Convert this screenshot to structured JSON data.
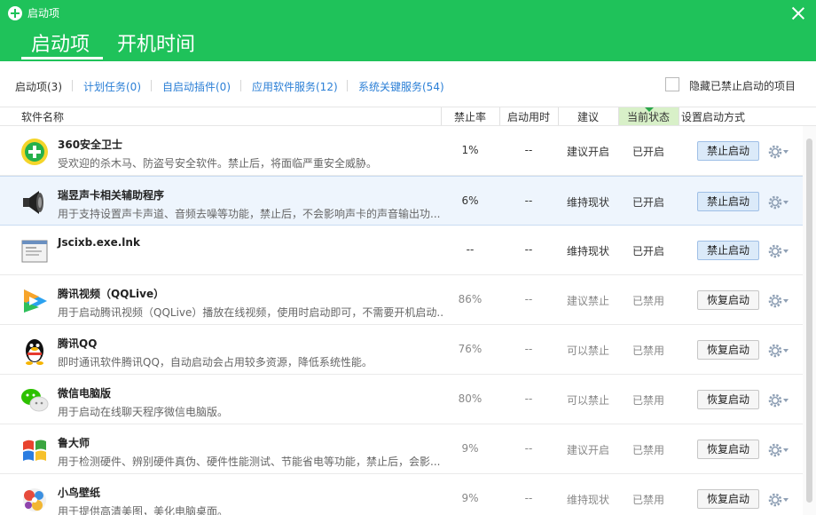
{
  "window": {
    "title": "启动项",
    "close_icon": "close-icon"
  },
  "header": {
    "tabs": [
      {
        "label": "启动项"
      },
      {
        "label": "开机时间"
      }
    ]
  },
  "subtabs": [
    {
      "label": "启动项(3)"
    },
    {
      "label": "计划任务(0)"
    },
    {
      "label": "自启动插件(0)"
    },
    {
      "label": "应用软件服务(12)"
    },
    {
      "label": "系统关键服务(54)"
    }
  ],
  "hide_disabled": {
    "label": "隐藏已禁止启动的项目",
    "checked": false
  },
  "columns": {
    "name": "软件名称",
    "disable_rate": "禁止率",
    "boot_time": "启动用时",
    "advice": "建议",
    "status": "当前状态",
    "config": "设置启动方式"
  },
  "rows": [
    {
      "name": "360安全卫士",
      "desc": "受欢迎的杀木马、防盗号安全软件。禁止后，将面临严重安全威胁。",
      "rate": "1%",
      "time": "--",
      "advice": "建议开启",
      "status": "已开启",
      "action": "禁止启动",
      "icon": "360-safe-icon"
    },
    {
      "name": "瑞昱声卡相关辅助程序",
      "desc": "用于支持设置声卡声道、音频去噪等功能，禁止后，不会影响声卡的声音输出功...",
      "rate": "6%",
      "time": "--",
      "advice": "维持现状",
      "status": "已开启",
      "action": "禁止启动",
      "icon": "speaker-icon"
    },
    {
      "name": "Jscixb.exe.lnk",
      "desc": "",
      "rate": "--",
      "time": "--",
      "advice": "维持现状",
      "status": "已开启",
      "action": "禁止启动",
      "icon": "window-file-icon"
    },
    {
      "name": "腾讯视频（QQLive）",
      "desc": "用于启动腾讯视频（QQLive）播放在线视频，使用时启动即可，不需要开机启动...",
      "rate": "86%",
      "time": "--",
      "advice": "建议禁止",
      "status": "已禁用",
      "action": "恢复启动",
      "icon": "tencent-video-icon"
    },
    {
      "name": "腾讯QQ",
      "desc": "即时通讯软件腾讯QQ，自动启动会占用较多资源，降低系统性能。",
      "rate": "76%",
      "time": "--",
      "advice": "可以禁止",
      "status": "已禁用",
      "action": "恢复启动",
      "icon": "qq-penguin-icon"
    },
    {
      "name": "微信电脑版",
      "desc": "用于启动在线聊天程序微信电脑版。",
      "rate": "80%",
      "time": "--",
      "advice": "可以禁止",
      "status": "已禁用",
      "action": "恢复启动",
      "icon": "wechat-icon"
    },
    {
      "name": "鲁大师",
      "desc": "用于检测硬件、辨别硬件真伪、硬件性能测试、节能省电等功能，禁止后，会影...",
      "rate": "9%",
      "time": "--",
      "advice": "建议开启",
      "status": "已禁用",
      "action": "恢复启动",
      "icon": "ludashi-icon"
    },
    {
      "name": "小鸟壁纸",
      "desc": "用于提供高清美图，美化电脑桌面。",
      "rate": "9%",
      "time": "--",
      "advice": "维持现状",
      "status": "已禁用",
      "action": "恢复启动",
      "icon": "bird-wallpaper-icon"
    }
  ],
  "colors": {
    "brand_green": "#1fc25a",
    "link_blue": "#2b7fd6",
    "active_col_bg": "#d8f0c8",
    "selected_row_bg": "#eef5fd"
  }
}
